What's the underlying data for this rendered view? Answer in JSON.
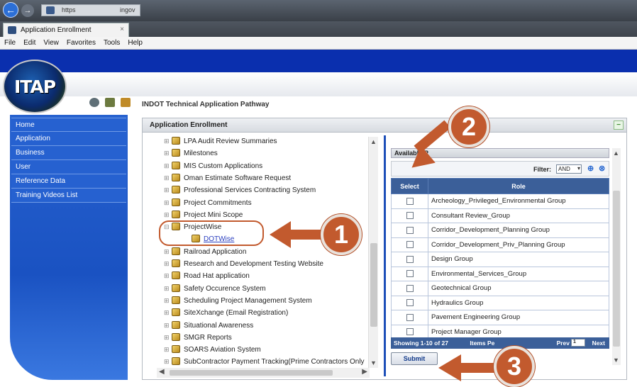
{
  "browser": {
    "address_text": "https",
    "address_suffix": "ingov",
    "tab_title": "Application Enrollment",
    "tab_close": "×",
    "menu": [
      "File",
      "Edit",
      "View",
      "Favorites",
      "Tools",
      "Help"
    ]
  },
  "app": {
    "logo_text": "ITAP",
    "title": "INDOT Technical Application Pathway",
    "header_icons": [
      "refresh-icon",
      "edit-icon",
      "people-icon"
    ]
  },
  "sidebar": {
    "items": [
      {
        "label": "Home"
      },
      {
        "label": "Application"
      },
      {
        "label": "Business"
      },
      {
        "label": "User"
      },
      {
        "label": "Reference Data"
      },
      {
        "label": "Training Videos List"
      }
    ]
  },
  "panel": {
    "title": "Application Enrollment",
    "collapse_label": "−"
  },
  "tree": {
    "items": [
      {
        "label": "LPA Audit Review Summaries",
        "expander": "⊞"
      },
      {
        "label": "Milestones",
        "expander": "⊞"
      },
      {
        "label": "MIS Custom Applications",
        "expander": "⊞"
      },
      {
        "label": "Oman Estimate Software Request",
        "expander": "⊞"
      },
      {
        "label": "Professional Services Contracting System",
        "expander": "⊞"
      },
      {
        "label": "Project Commitments",
        "expander": "⊞"
      },
      {
        "label": "Project Mini Scope",
        "expander": "⊞"
      },
      {
        "label": "ProjectWise",
        "expander": "⊟"
      },
      {
        "label": "DOTWise",
        "expander": "",
        "child": true
      },
      {
        "label": "Railroad Application",
        "expander": "⊞"
      },
      {
        "label": "Research and Development Testing Website",
        "expander": "⊞"
      },
      {
        "label": "Road Hat application",
        "expander": "⊞"
      },
      {
        "label": "Safety Occurence System",
        "expander": "⊞"
      },
      {
        "label": "Scheduling Project Management System",
        "expander": "⊞"
      },
      {
        "label": "SiteXchange (Email Registration)",
        "expander": "⊞"
      },
      {
        "label": "Situational Awareness",
        "expander": "⊞"
      },
      {
        "label": "SMGR Reports",
        "expander": "⊞"
      },
      {
        "label": "SOARS Aviation System",
        "expander": "⊞"
      },
      {
        "label": "SubContractor Payment Tracking(Prime Contractors Only",
        "expander": "⊞"
      }
    ]
  },
  "roles": {
    "header": "Available R",
    "filter_label": "Filter:",
    "filter_value": "AND",
    "columns": {
      "select": "Select",
      "role": "Role"
    },
    "rows": [
      {
        "role": "Archeology_Privileged_Environmental Group"
      },
      {
        "role": "Consultant Review_Group"
      },
      {
        "role": "Corridor_Development_Planning Group"
      },
      {
        "role": "Corridor_Development_Priv_Planning Group"
      },
      {
        "role": "Design Group"
      },
      {
        "role": "Environmental_Services_Group"
      },
      {
        "role": "Geotechnical Group"
      },
      {
        "role": "Hydraulics Group"
      },
      {
        "role": "Pavement Engineering Group"
      },
      {
        "role": "Project Manager Group"
      }
    ],
    "pager_text": "Showing 1-10 of 27",
    "pager_middle": "Items Pe",
    "prev_label": "Prev",
    "page_value": "1",
    "next_label": "Next",
    "submit_label": "Submit"
  },
  "annotations": {
    "badge_1": "1",
    "badge_2": "2",
    "badge_3": "3",
    "color": "#c25a2e"
  }
}
